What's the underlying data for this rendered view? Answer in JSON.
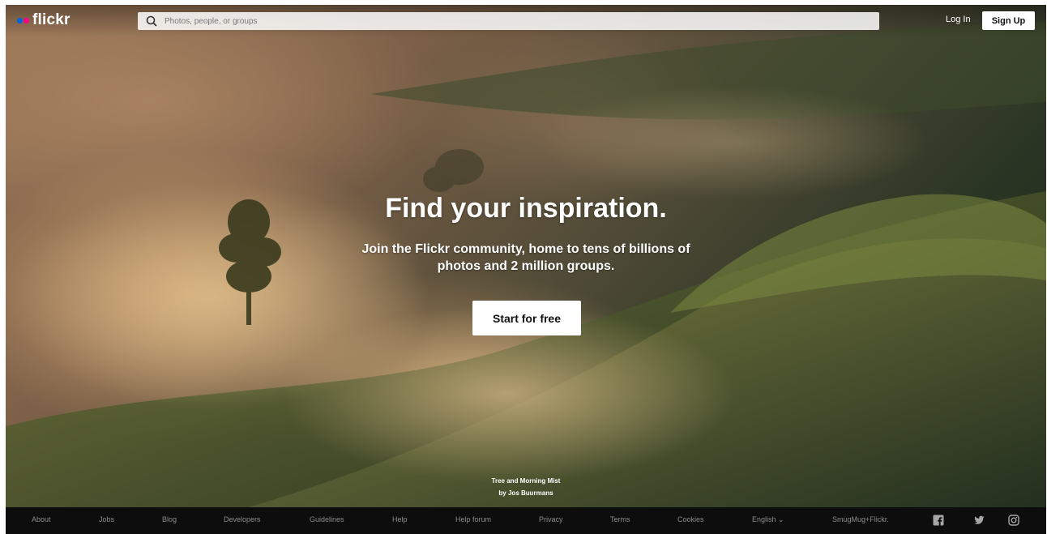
{
  "header": {
    "logo_text": "flickr",
    "logo_dot_colors": [
      "#0063dc",
      "#ff0084"
    ],
    "search_placeholder": "Photos, people, or groups",
    "login_label": "Log In",
    "signup_label": "Sign Up"
  },
  "hero": {
    "headline": "Find your inspiration.",
    "subline": "Join the Flickr community, home to tens of billions of photos and 2 million groups.",
    "cta_label": "Start for free",
    "photo_title": "Tree and Morning Mist",
    "photo_credit": "by Jos Buurmans"
  },
  "footer": {
    "links": [
      {
        "label": "About"
      },
      {
        "label": "Jobs"
      },
      {
        "label": "Blog"
      },
      {
        "label": "Developers"
      },
      {
        "label": "Guidelines"
      },
      {
        "label": "Help"
      },
      {
        "label": "Help forum"
      },
      {
        "label": "Privacy"
      },
      {
        "label": "Terms"
      },
      {
        "label": "Cookies"
      },
      {
        "label": "English ⌄"
      },
      {
        "label": "SmugMug+Flickr."
      }
    ],
    "social": [
      "facebook-icon",
      "twitter-icon",
      "instagram-icon"
    ]
  },
  "colors": {
    "footer_bg": "#0d0d0d",
    "footer_text": "#8c8c8c",
    "button_bg": "#ffffff"
  }
}
